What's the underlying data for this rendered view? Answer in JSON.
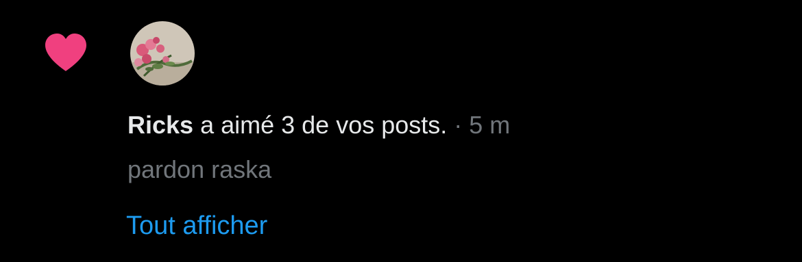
{
  "notification": {
    "type_icon": "heart-icon",
    "avatar": "avatar-flowers",
    "username": "Ricks",
    "action_text": " a aimé 3 de vos posts.",
    "separator": " · ",
    "time": "5 m",
    "post_excerpt": "pardon raska",
    "show_all_label": "Tout afficher"
  },
  "colors": {
    "background": "#000000",
    "heart": "#f0407f",
    "text_primary": "#e7e9ea",
    "text_secondary": "#71767b",
    "link": "#1d9bf0"
  }
}
